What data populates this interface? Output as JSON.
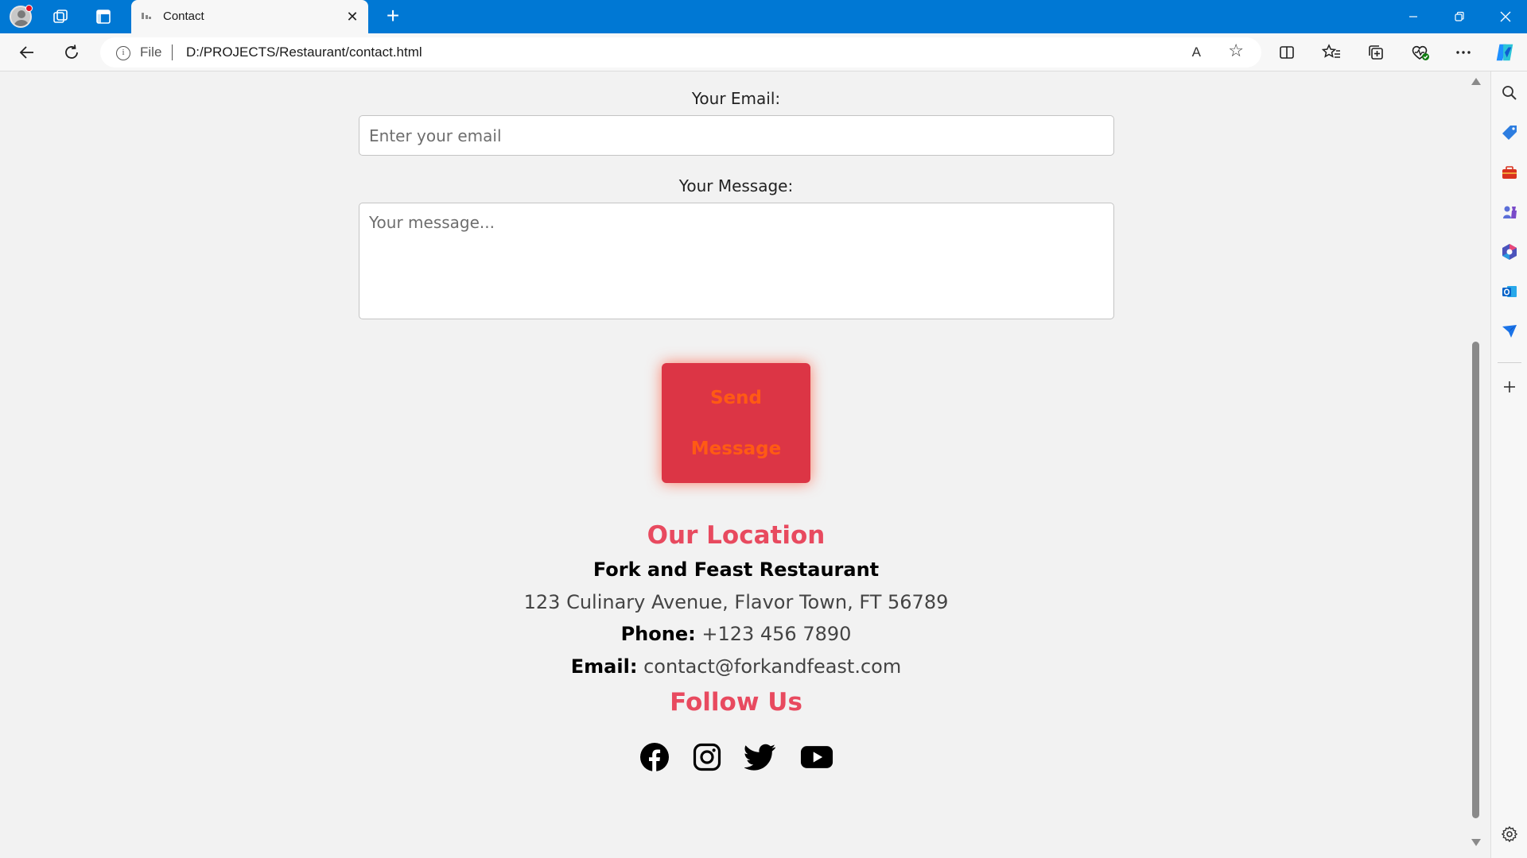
{
  "browser": {
    "tab_title": "Contact",
    "tab_close": "✕",
    "new_tab": "+",
    "scheme": "File",
    "url": "D:/PROJECTS/Restaurant/contact.html",
    "read_aloud": "A",
    "minimize": "—",
    "close": "✕"
  },
  "form": {
    "email_label": "Your Email:",
    "email_placeholder": "Enter your email",
    "message_label": "Your Message:",
    "message_placeholder": "Your message...",
    "send_line1": "Send",
    "send_line2": "Message"
  },
  "location": {
    "heading": "Our Location",
    "name": "Fork and Feast Restaurant",
    "address": "123 Culinary Avenue, Flavor Town, FT 56789",
    "phone_label": "Phone:",
    "phone": "+123 456 7890",
    "email_label": "Email:",
    "email": "contact@forkandfeast.com"
  },
  "follow": {
    "heading": "Follow Us",
    "icons": [
      "facebook-icon",
      "instagram-icon",
      "twitter-icon",
      "youtube-icon"
    ]
  },
  "colors": {
    "chrome_blue": "#0078d4",
    "accent_red": "#e84a5f",
    "button_red": "#dc3545",
    "button_text": "#ff5a14"
  }
}
